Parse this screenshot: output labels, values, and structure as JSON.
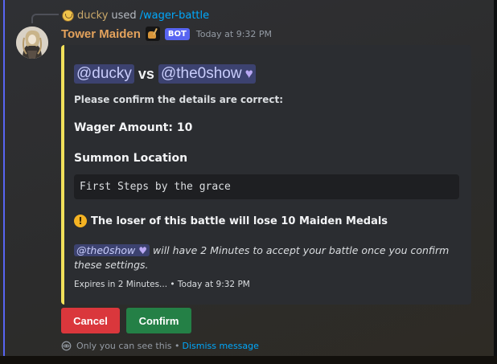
{
  "command": {
    "user": "ducky",
    "used_text": "used",
    "name": "/wager-battle"
  },
  "message": {
    "author": "Tower Maiden",
    "bot_badge": "BOT",
    "timestamp": "Today at 9:32 PM"
  },
  "embed": {
    "accent_color": "#f1e05a",
    "title_left_mention": "@ducky",
    "title_vs": "vs",
    "title_right_mention": "@the0show",
    "description": "Please confirm the details are correct:",
    "wager": "Wager Amount: 10",
    "field_name": "Summon Location",
    "field_value": "First Steps by the grace",
    "warning_icon": "exclamation-icon",
    "warning": "The loser of this battle will lose 10 Maiden Medals",
    "accept_mention": "@the0show",
    "accept_text": "will have 2 Minutes to accept your battle once you confirm these settings.",
    "footer": "Expires in 2 Minutes... • Today at 9:32 PM"
  },
  "buttons": {
    "cancel": "Cancel",
    "confirm": "Confirm"
  },
  "ephemeral": {
    "text": "Only you can see this •",
    "dismiss": "Dismiss message"
  },
  "colors": {
    "author": "#e3a25c",
    "bot_badge": "#5865f2",
    "cancel": "#da373c",
    "confirm": "#248046",
    "link": "#00a8fc"
  }
}
